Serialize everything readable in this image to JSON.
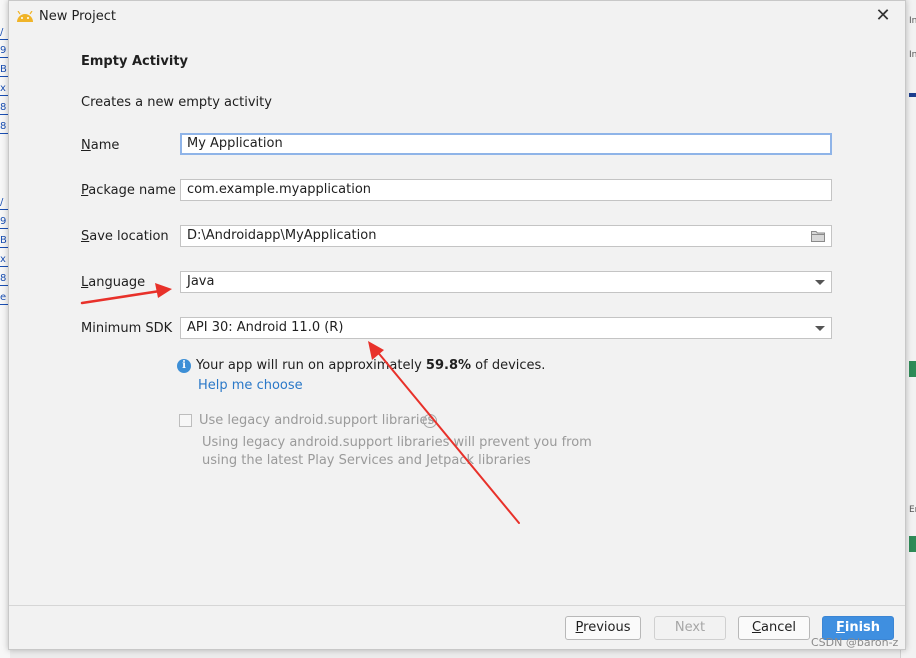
{
  "window": {
    "title": "New Project",
    "close_glyph": "✕"
  },
  "heading": "Empty Activity",
  "subheading": "Creates a new empty activity",
  "form": {
    "name": {
      "label_first": "N",
      "label_rest": "ame",
      "value": "My Application"
    },
    "package": {
      "label_first": "P",
      "label_rest": "ackage name",
      "value": "com.example.myapplication"
    },
    "save_location": {
      "label_first": "S",
      "label_rest": "ave location",
      "value": "D:\\Androidapp\\MyApplication"
    },
    "language": {
      "label_first": "L",
      "label_rest": "anguage",
      "value": "Java"
    },
    "min_sdk": {
      "label": "Minimum SDK",
      "value": "API 30: Android 11.0 (R)"
    }
  },
  "info": {
    "icon_glyph": "i",
    "prefix": "Your app will run on approximately ",
    "percent": "59.8%",
    "suffix": " of devices.",
    "help_link": "Help me choose"
  },
  "legacy": {
    "label": "Use legacy android.support libraries",
    "help_glyph": "?",
    "description": "Using legacy android.support libraries will prevent you from using the latest Play Services and Jetpack libraries",
    "checked": false
  },
  "buttons": {
    "previous_first": "P",
    "previous_rest": "revious",
    "next": "Next",
    "cancel_first": "C",
    "cancel_rest": "ancel",
    "finish_first": "F",
    "finish_rest": "inish"
  },
  "watermark": "CSDN @baron-z",
  "colors": {
    "accent": "#3f8fe0",
    "link": "#2a78c8",
    "annotation_arrow": "#e8312a",
    "android_icon": "#f0b429"
  },
  "background_fragments": {
    "left": [
      "/",
      "9",
      "B",
      "x",
      "8",
      "8",
      "/",
      "9",
      "B",
      "x",
      "8",
      "e"
    ],
    "right": [
      "In",
      "In",
      "Em"
    ]
  }
}
